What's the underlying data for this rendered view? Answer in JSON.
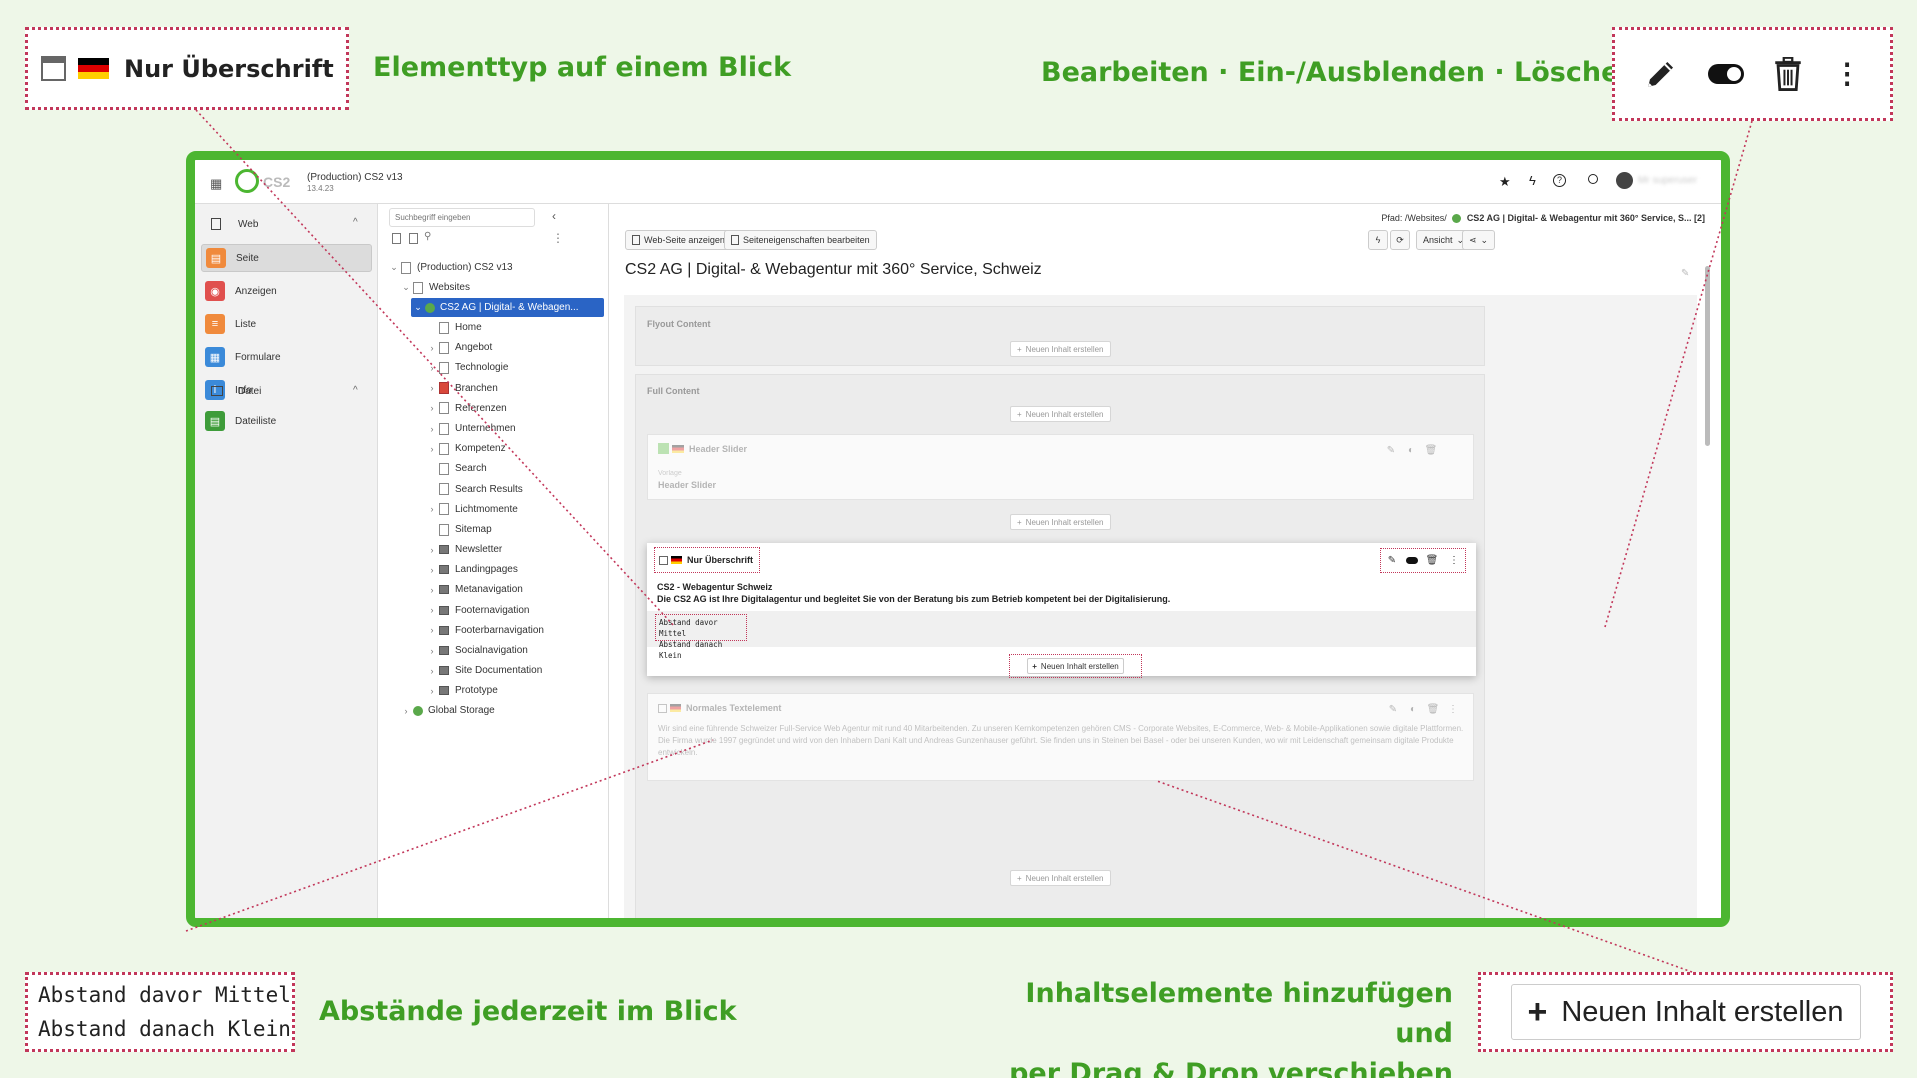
{
  "colors": {
    "brand_green": "#4cb631",
    "headline_green": "#3f9e24",
    "callout_border": "#c2375a",
    "selected": "#2a64c5"
  },
  "callouts": {
    "element_type": {
      "label": "Nur Überschrift",
      "headline": "Elementtyp auf einem Blick"
    },
    "actions": {
      "headline": "Bearbeiten · Ein-/Ausblenden · Löschen",
      "icons": [
        "pencil-icon",
        "toggle-icon",
        "trash-icon",
        "more-vertical-icon"
      ]
    },
    "spacing": {
      "line1": "Abstand davor Mittel",
      "line2": "Abstand danach Klein",
      "headline": "Abstände jederzeit im Blick"
    },
    "add": {
      "button_label": "Neuen Inhalt erstellen",
      "headline_line1": "Inhaltselemente hinzufügen und",
      "headline_line2": "per Drag & Drop verschieben"
    }
  },
  "app": {
    "instance": "(Production) CS2 v13",
    "version": "13.4.23",
    "logo_text": "CS2",
    "user": "Mr superuser",
    "sidebar": {
      "web_heading": "Web",
      "items": [
        {
          "label": "Seite",
          "icon": "page-icon",
          "color": "#f08a3c"
        },
        {
          "label": "Anzeigen",
          "icon": "eye-icon",
          "color": "#e0504e"
        },
        {
          "label": "Liste",
          "icon": "list-icon",
          "color": "#f08a3c"
        },
        {
          "label": "Formulare",
          "icon": "form-icon",
          "color": "#3b8ad9"
        },
        {
          "label": "Info",
          "icon": "info-icon",
          "color": "#3b8ad9"
        }
      ],
      "file_heading": "Datei",
      "file_items": [
        {
          "label": "Dateiliste",
          "icon": "file-list-icon",
          "color": "#3e9c3a"
        }
      ]
    },
    "tree": {
      "search_placeholder": "Suchbegriff eingeben",
      "root": "(Production) CS2 v13",
      "websites": "Websites",
      "site": "CS2 AG | Digital- & Webagen...",
      "pages": [
        "Home",
        "Angebot",
        "Technologie",
        "Branchen",
        "Referenzen",
        "Unternehmen",
        "Kompetenz",
        "Search",
        "Search Results",
        "Lichtmomente",
        "Sitemap"
      ],
      "folders": [
        "Newsletter",
        "Landingpages",
        "Metanavigation",
        "Footernavigation",
        "Footerbarnavigation",
        "Socialnavigation",
        "Site Documentation",
        "Prototype"
      ],
      "global": "Global Storage"
    },
    "main": {
      "path": "Pfad: /Websites/",
      "path_current": "CS2 AG | Digital- & Webagentur mit 360° Service, S... [2]",
      "btn_view": "Web-Seite anzeigen",
      "btn_props": "Seiteneigenschaften bearbeiten",
      "btn_ansicht": "Ansicht",
      "page_title": "CS2 AG | Digital- & Webagentur mit 360° Service, Schweiz",
      "flyout": "Flyout Content",
      "full": "Full Content",
      "add_label": "Neuen Inhalt erstellen",
      "header_slider": {
        "type": "Header Slider",
        "meta": "Vorlage",
        "name": "Header Slider"
      },
      "element": {
        "type": "Nur Überschrift",
        "headline": "CS2 - Webagentur Schweiz",
        "text": "Die CS2 AG ist Ihre Digitalagentur und begleitet Sie von der Beratung bis zum Betrieb kompetent bei der Digitalisierung.",
        "space1": "Abstand davor Mittel",
        "space2": "Abstand danach Klein"
      },
      "text_element": {
        "type": "Normales Textelement",
        "text": "Wir sind eine führende Schweizer Full-Service Web Agentur mit rund 40 Mitarbeitenden. Zu unseren Kernkompetenzen gehören CMS - Corporate Websites, E-Commerce, Web- & Mobile-Applikationen sowie digitale Plattformen. Die Firma wurde 1997 gegründet und wird von den Inhabern Dani Kalt und Andreas Gunzenhauser geführt. Sie finden uns in Steinen bei Basel - oder bei unseren Kunden, wo wir mit Leidenschaft gemeinsam digitale Produkte entwickeln."
      }
    }
  }
}
